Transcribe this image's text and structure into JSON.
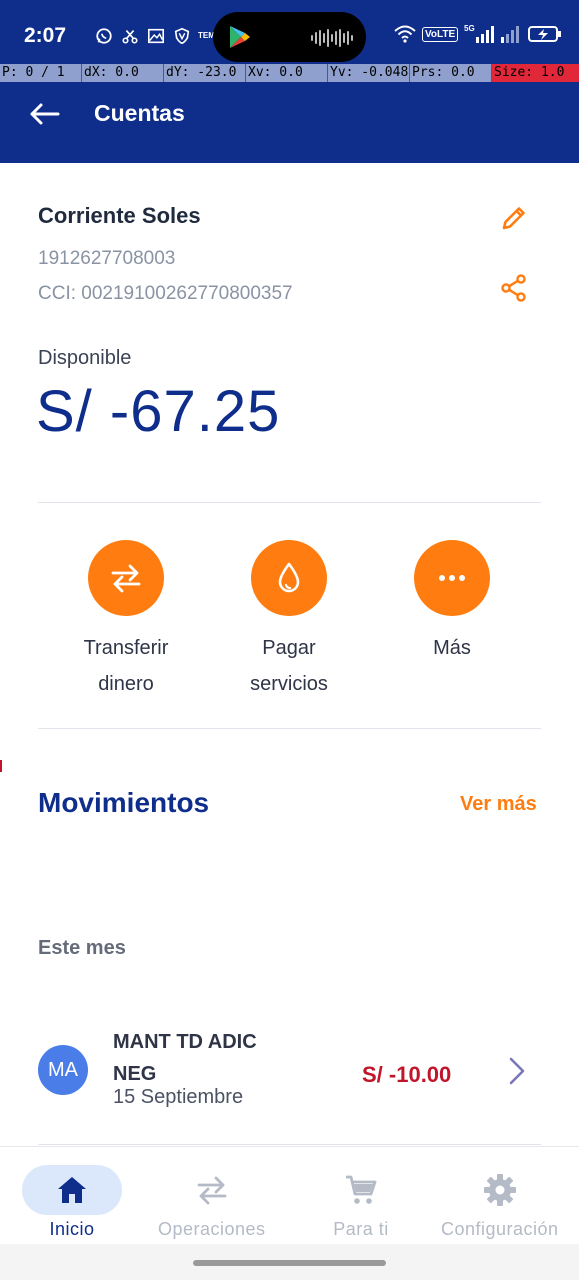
{
  "status_bar": {
    "time": "2:07",
    "temu_label": "TEMU",
    "volte_label": "VoLTE",
    "network_label": "5G"
  },
  "debug_bar": {
    "cells": [
      "P: 0 / 1",
      "dX: 0.0",
      "dY: -23.0",
      "Xv: 0.0",
      "Yv: -0.048",
      "Prs: 0.0",
      "Size: 1.0"
    ]
  },
  "header": {
    "title": "Cuentas",
    "back_icon": "arrow-left-icon"
  },
  "account": {
    "name": "Corriente Soles",
    "number": "1912627708003",
    "cci": "CCI: 00219100262770800357",
    "available_label": "Disponible",
    "balance": "S/ -67.25"
  },
  "actions": [
    {
      "label": "Transferir\ndinero",
      "icon": "transfer-icon"
    },
    {
      "label": "Pagar\nservicios",
      "icon": "drop-icon"
    },
    {
      "label": "Más",
      "icon": "more-icon"
    }
  ],
  "movements": {
    "title": "Movimientos",
    "more_link": "Ver más",
    "month_label": "Este mes",
    "items": [
      {
        "initials": "MA",
        "description": "MANT TD ADIC NEG",
        "date": "15 Septiembre",
        "amount": "S/ -10.00"
      }
    ]
  },
  "bottom_nav": [
    {
      "label": "Inicio",
      "icon": "home-icon",
      "active": true
    },
    {
      "label": "Operaciones",
      "icon": "swap-icon",
      "active": false
    },
    {
      "label": "Para ti",
      "icon": "cart-icon",
      "active": false
    },
    {
      "label": "Configuración",
      "icon": "gear-icon",
      "active": false
    }
  ],
  "colors": {
    "brand_blue": "#0f2e8c",
    "accent_orange": "#ff7d10",
    "negative_red": "#c0152a",
    "avatar_blue": "#4a7de8",
    "nav_active_bg": "#dbe8fb"
  }
}
